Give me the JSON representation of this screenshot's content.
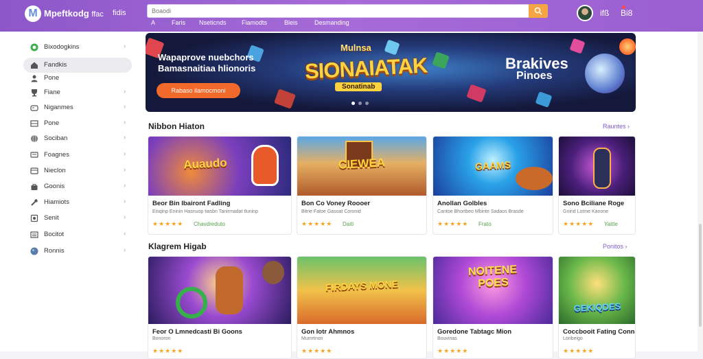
{
  "header": {
    "logo_letter": "M",
    "brand": "Mpeftkodg",
    "brand_suffix": "ffac",
    "brand_sub": "fidis",
    "search_placeholder": "Boaodi",
    "nav": [
      "A",
      "Faris",
      "Nseticnds",
      "Fiamodts",
      "Bleis",
      "Desmanding"
    ],
    "user_a": "ifß",
    "user_b": "Bi8"
  },
  "sidebar": {
    "items": [
      {
        "label": "Bixodogkins",
        "icon": "circle-logo-icon",
        "active": false
      },
      {
        "label": "Fandkis",
        "icon": "home-icon",
        "active": true
      },
      {
        "label": "Pone",
        "icon": "user-icon",
        "active": false
      },
      {
        "label": "Fiane",
        "icon": "trophy-icon",
        "active": false
      },
      {
        "label": "Niganmes",
        "icon": "gamepad-icon",
        "active": false
      },
      {
        "label": "Pone",
        "icon": "grid-icon",
        "active": false
      },
      {
        "label": "Sociban",
        "icon": "globe-icon",
        "active": false
      },
      {
        "label": "Foagnes",
        "icon": "chat-icon",
        "active": false
      },
      {
        "label": "Nieclon",
        "icon": "card-icon",
        "active": false
      },
      {
        "label": "Goonis",
        "icon": "bag-icon",
        "active": false
      },
      {
        "label": "Hiamiots",
        "icon": "tools-icon",
        "active": false
      },
      {
        "label": "Senit",
        "icon": "gear-icon",
        "active": false
      },
      {
        "label": "Bocitot",
        "icon": "list-icon",
        "active": false
      },
      {
        "label": "Ronnis",
        "icon": "planet-icon",
        "active": false
      }
    ]
  },
  "hero": {
    "line1": "Wapaprove nuebchors",
    "line2": "Bamasnaitiaa hlionoris",
    "cta": "Rabaso ilamocmoni",
    "title": "SIONAIATAK",
    "tag": "Sonatinab",
    "right_title": "Brakives",
    "right_sub": "Pinoes",
    "logo_top": "Mulnsa"
  },
  "sections": [
    {
      "title": "Nibbon Hiaton",
      "more": "Rauntes",
      "cards": [
        {
          "art": "Auaudo",
          "name": "Beor Bin Ibairont Fadling",
          "meta": "Eisqinp  Eninin   Hasnuop tiasbn   Tanirmadat tluninp",
          "stars": "★★★★★",
          "rating": "Chavdreduto"
        },
        {
          "art": "CIEWEA",
          "name": "Bon Co Voney Roooer",
          "meta": "Bitrie   Fatoe  Gasoat   Coronid",
          "stars": "★★★★★",
          "rating": "Daiti"
        },
        {
          "art": "GAAMS",
          "name": "Anollan Golbles",
          "meta": "Cantoe  Bhortbeo   Mbinte  Sadaos  Brasde",
          "stars": "★★★★★",
          "rating": "Frato"
        },
        {
          "art": "",
          "name": "Sono Bciliane Roge",
          "meta": "Gnirid  Lotme  Kanone",
          "stars": "★★★★★",
          "rating": "Yaitte"
        }
      ]
    },
    {
      "title": "Klagrem Higab",
      "more": "Ponitos",
      "cards": [
        {
          "art": "",
          "name": "Feor O Lmnedcasti Bi Goons",
          "meta": "Bonoron",
          "stars": "★★★★★",
          "rating": ""
        },
        {
          "art": "FIRDAYS MONE",
          "name": "Gon Iotr Ahmnos",
          "meta": "Mumrtnon",
          "stars": "★★★★★",
          "rating": ""
        },
        {
          "art": "NOITENE POES",
          "name": "Goredone Tabtagc Mion",
          "meta": "Bouvinas",
          "stars": "★★★★★",
          "rating": ""
        },
        {
          "art": "GEKIQDES",
          "name": "Coccbooit Fating Conna",
          "meta": "Loribeigo",
          "stars": "★★★★★",
          "rating": ""
        }
      ]
    }
  ],
  "colors": {
    "header_start": "#8d57c9",
    "header_end": "#a66bd8",
    "accent_orange": "#f26a2b",
    "search_button": "#f6a545",
    "link_purple": "#7b5cc6",
    "star": "#f2a623"
  }
}
